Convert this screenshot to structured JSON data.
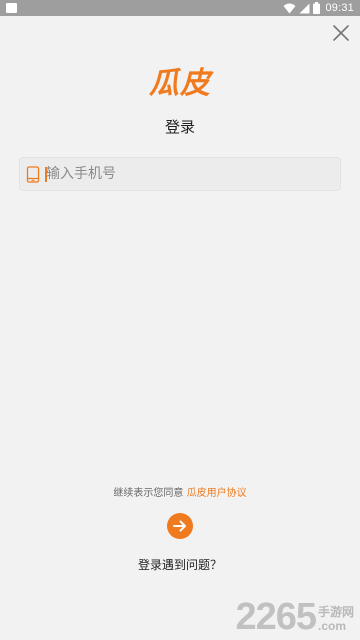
{
  "status_bar": {
    "time": "09:31",
    "icons": [
      "wifi-icon",
      "signal-icon",
      "battery-icon"
    ]
  },
  "close": {
    "icon": "close-icon"
  },
  "brand": {
    "logo_text": "瓜皮",
    "color": "#f07a1e"
  },
  "login": {
    "title": "登录",
    "phone_placeholder": "输入手机号",
    "phone_value": "",
    "phone_icon": "phone-icon"
  },
  "agreement": {
    "prefix": "继续表示您同意",
    "link": "瓜皮用户协议"
  },
  "submit": {
    "icon": "arrow-right-icon"
  },
  "help": {
    "label": "登录遇到问题？"
  },
  "watermark": {
    "number": "2265",
    "site": "手游网",
    "domain": ".com"
  }
}
